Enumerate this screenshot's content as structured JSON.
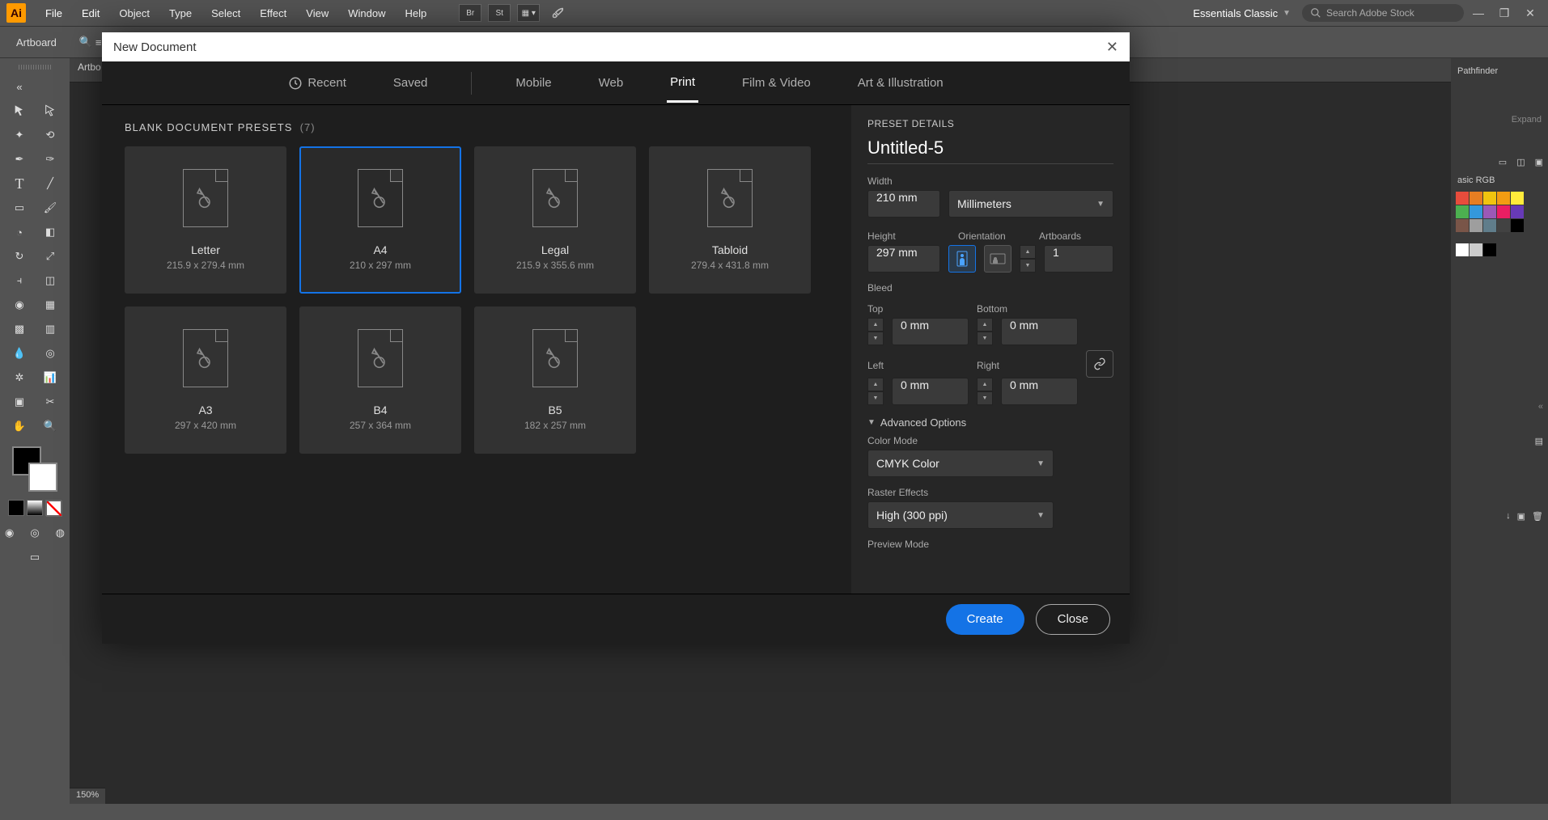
{
  "menubar": {
    "items": [
      "File",
      "Edit",
      "Object",
      "Type",
      "Select",
      "Effect",
      "View",
      "Window",
      "Help"
    ],
    "workspace": "Essentials Classic",
    "search_placeholder": "Search Adobe Stock"
  },
  "ctrlbar": {
    "label": "Artboard"
  },
  "doc_tab": "Artbo",
  "zoom": "150%",
  "rightpanel": {
    "pathfinder": "Pathfinder",
    "expand": "Expand",
    "basicRGB": "asic RGB"
  },
  "modal": {
    "title": "New Document",
    "tabs": [
      "Recent",
      "Saved",
      "Mobile",
      "Web",
      "Print",
      "Film & Video",
      "Art & Illustration"
    ],
    "active_tab": "Print",
    "presets_header": "BLANK DOCUMENT PRESETS",
    "presets_count": "(7)",
    "presets": [
      {
        "name": "Letter",
        "dims": "215.9 x 279.4 mm"
      },
      {
        "name": "A4",
        "dims": "210 x 297 mm",
        "selected": true
      },
      {
        "name": "Legal",
        "dims": "215.9 x 355.6 mm"
      },
      {
        "name": "Tabloid",
        "dims": "279.4 x 431.8 mm"
      },
      {
        "name": "A3",
        "dims": "297 x 420 mm"
      },
      {
        "name": "B4",
        "dims": "257 x 364 mm"
      },
      {
        "name": "B5",
        "dims": "182 x 257 mm"
      }
    ],
    "details": {
      "section": "PRESET DETAILS",
      "name": "Untitled-5",
      "width_label": "Width",
      "width_value": "210 mm",
      "units": "Millimeters",
      "height_label": "Height",
      "height_value": "297 mm",
      "orientation_label": "Orientation",
      "artboards_label": "Artboards",
      "artboards_value": "1",
      "bleed_label": "Bleed",
      "top_label": "Top",
      "top_value": "0 mm",
      "bottom_label": "Bottom",
      "bottom_value": "0 mm",
      "left_label": "Left",
      "left_value": "0 mm",
      "right_label": "Right",
      "right_value": "0 mm",
      "advanced": "Advanced Options",
      "color_mode_label": "Color Mode",
      "color_mode_value": "CMYK Color",
      "raster_label": "Raster Effects",
      "raster_value": "High (300 ppi)",
      "preview_label": "Preview Mode"
    },
    "buttons": {
      "create": "Create",
      "close": "Close"
    }
  },
  "swatch_colors": [
    "#e74c3c",
    "#e67e22",
    "#f1c40f",
    "#f39c12",
    "#ffeb3b",
    "#4caf50",
    "#3498db",
    "#9b59b6",
    "#e91e63",
    "#673ab7",
    "#795548",
    "#9e9e9e",
    "#607d8b",
    "#424242",
    "#000000"
  ]
}
